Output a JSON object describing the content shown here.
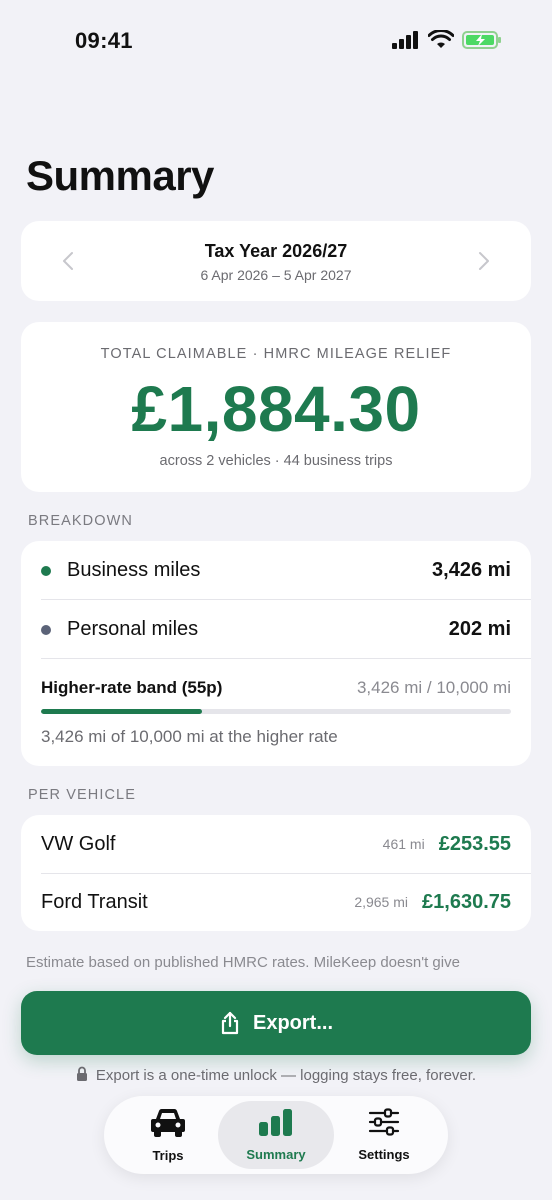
{
  "status_bar": {
    "time": "09:41",
    "icons": [
      "signal-icon",
      "wifi-icon",
      "battery-charging-icon"
    ]
  },
  "page_title": "Summary",
  "tax_year": {
    "title": "Tax Year 2026/27",
    "range": "6 Apr 2026 – 5 Apr 2027",
    "prev_icon": "chevron-left-icon",
    "next_icon": "chevron-right-icon"
  },
  "total": {
    "label": "TOTAL CLAIMABLE · HMRC MILEAGE RELIEF",
    "amount": "£1,884.30",
    "sub": "across 2 vehicles · 44 business trips"
  },
  "breakdown": {
    "section_label": "BREAKDOWN",
    "business": {
      "label": "Business miles",
      "value": "3,426 mi",
      "dot_color": "#1e7a4f"
    },
    "personal": {
      "label": "Personal miles",
      "value": "202 mi",
      "dot_color": "#5b6378"
    },
    "band": {
      "title": "Higher-rate band (55p)",
      "fraction": "3,426 mi / 10,000 mi",
      "progress": 0.3426,
      "note": "3,426 mi of 10,000 mi at the higher rate"
    }
  },
  "vehicles": {
    "section_label": "PER VEHICLE",
    "items": [
      {
        "name": "VW Golf",
        "miles": "461 mi",
        "amount": "£253.55"
      },
      {
        "name": "Ford Transit",
        "miles": "2,965 mi",
        "amount": "£1,630.75"
      }
    ]
  },
  "disclaimer": "Estimate based on published HMRC rates. MileKeep doesn't give",
  "export": {
    "label": "Export...",
    "icon": "share-icon"
  },
  "unlock_note": {
    "text": "Export is a one-time unlock — logging stays free, forever.",
    "icon": "lock-icon"
  },
  "tabs": [
    {
      "label": "Trips",
      "icon": "car-icon",
      "active": false
    },
    {
      "label": "Summary",
      "icon": "bar-chart-icon",
      "active": true
    },
    {
      "label": "Settings",
      "icon": "sliders-icon",
      "active": false
    }
  ],
  "colors": {
    "accent": "#1e7a4f",
    "background": "#f2f2f7",
    "personal": "#5b6378"
  }
}
